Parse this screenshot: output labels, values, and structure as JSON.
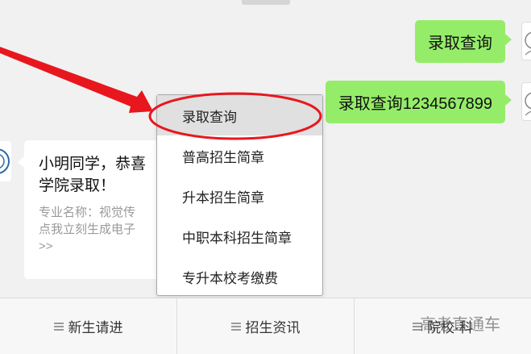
{
  "messages_out": [
    {
      "text": "录取查询"
    },
    {
      "text": "录取查询1234567899"
    }
  ],
  "incoming": {
    "headline": "小明同学，恭喜\n学院录取！",
    "headline_line1": "小明同学，恭喜",
    "headline_line2": "学院录取！",
    "sub_line1": "专业名称：视觉传",
    "sub_line2": "点我立刻生成电子",
    "sub_line3": ">>"
  },
  "popup_menu": {
    "items": [
      {
        "label": "录取查询",
        "selected": true
      },
      {
        "label": "普高招生简章",
        "selected": false
      },
      {
        "label": "升本招生简章",
        "selected": false
      },
      {
        "label": "中职本科招生简章",
        "selected": false
      },
      {
        "label": "专升本校考缴费",
        "selected": false
      }
    ]
  },
  "bottom_menu": {
    "tabs": [
      {
        "label": "新生请进",
        "icon": "menu-icon"
      },
      {
        "label": "招生资讯",
        "icon": "menu-icon"
      },
      {
        "label": "院校·科",
        "icon": "menu-icon"
      }
    ]
  },
  "watermark": "高考直通车",
  "colors": {
    "outgoing_bubble": "#95ec69",
    "annotation_red": "#e8171e",
    "background": "#f1f1f1"
  }
}
